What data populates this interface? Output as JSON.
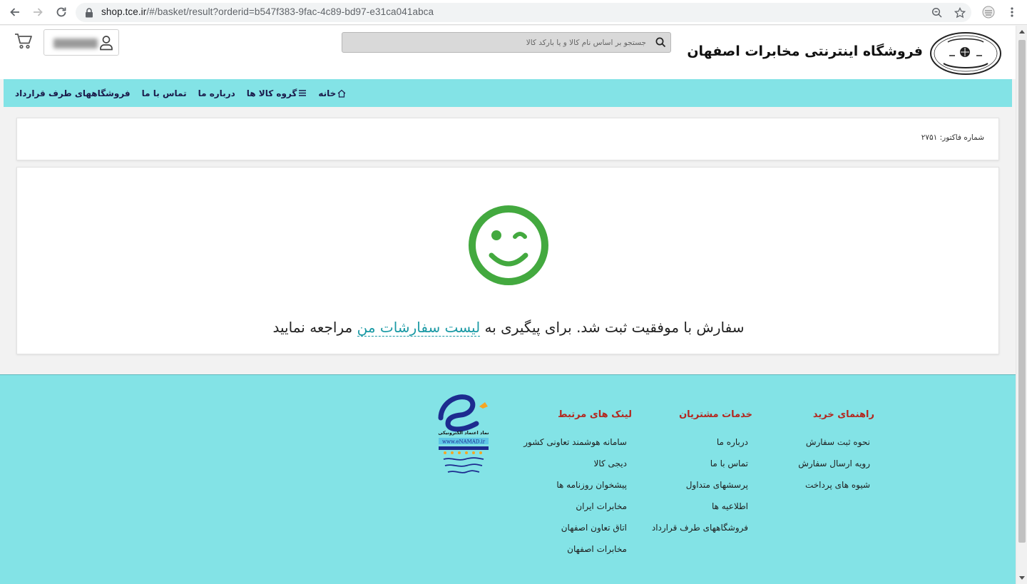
{
  "browser": {
    "url_host": "shop.tce.ir",
    "url_path": "/#/basket/result?orderid=b547f383-9fac-4c89-bd97-e31ca041abca"
  },
  "header": {
    "site_title": "فروشگاه اینترنتی مخابرات اصفهان",
    "search_placeholder": "جستجو بر اساس نام کالا و یا بارکد کالا"
  },
  "nav": {
    "home": "خانه",
    "product_groups": "گروه کالا ها",
    "about": "درباره ما",
    "contact": "تماس با ما",
    "contract_stores": "فروشگاههای طرف قرارداد"
  },
  "invoice": {
    "label": "شماره فاکتور:",
    "number": "۲۷۵۱"
  },
  "result": {
    "text_before": "سفارش با موفقیت ثبت شد. برای پیگیری به ",
    "link": "لیست سفارشات من",
    "text_after": " مراجعه نمایید"
  },
  "footer": {
    "guide": {
      "title": "راهنمای خرید",
      "items": [
        "نحوه ثبت سفارش",
        "رویه ارسال سفارش",
        "شیوه های پرداخت"
      ]
    },
    "services": {
      "title": "خدمات مشتریان",
      "items": [
        "درباره ما",
        "تماس با ما",
        "پرسشهای متداول",
        "اطلاعیه ها",
        "فروشگاههای طرف قرارداد"
      ]
    },
    "links": {
      "title": "لینک های مرتبط",
      "items": [
        "سامانه هوشمند تعاونی کشور",
        "دیجی کالا",
        "پیشخوان روزنامه ها",
        "مخابرات ایران",
        "اتاق تعاون اصفهان",
        "مخابرات اصفهان"
      ]
    },
    "enamad": {
      "line1": "نماد اعتماد الکترونیکی",
      "line2": "www.eNAMAD.ir"
    }
  },
  "colors": {
    "accent": "#83e3e6",
    "success": "#43a93f",
    "link": "#1b9aa5",
    "footer_heading": "#b3271f"
  }
}
